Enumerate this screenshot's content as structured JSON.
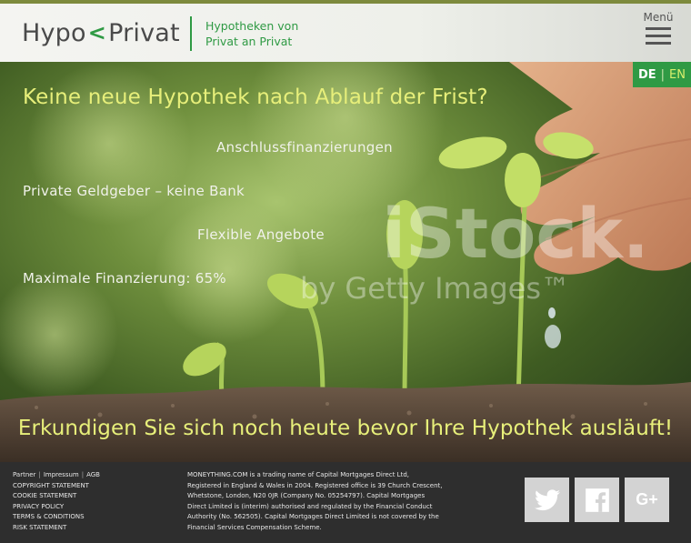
{
  "header": {
    "logo_left": "Hypo",
    "logo_chevron": "<",
    "logo_right": "Privat",
    "tagline_line1": "Hypotheken von",
    "tagline_line2": "Privat an Privat",
    "menu_label": "Menü"
  },
  "language": {
    "de": "DE",
    "separator": "|",
    "en": "EN"
  },
  "hero": {
    "title": "Keine neue Hypothek nach Ablauf der Frist?",
    "features": [
      "Anschlussfinanzierungen",
      "Private Geldgeber – keine Bank",
      "Flexible Angebote",
      "Maximale Finanzierung: 65%"
    ],
    "watermark_logo": "iStock.",
    "watermark_text": "by Getty Images™",
    "cta": "Erkundigen Sie sich noch heute bevor Ihre Hypothek ausläuft!"
  },
  "footer": {
    "links_row1": [
      "Partner",
      "Impressum",
      "AGB"
    ],
    "links": [
      "COPYRIGHT STATEMENT",
      "COOKIE STATEMENT",
      "PRIVACY POLICY",
      "TERMS & CONDITIONS",
      "RISK STATEMENT"
    ],
    "legal_lines": [
      "MONEYTHING.COM is a trading name of Capital Mortgages Direct Ltd,",
      "Registered in England & Wales in 2004. Registered office is 39 Church Crescent,",
      "Whetstone, London, N20 0JR (Company No. 05254797). Capital Mortgages",
      "Direct Limited is (interim) authorised and regulated by the Financial Conduct",
      "Authority (No. 562505). Capital Mortgages Direct Limited is not covered by the",
      "Financial Services Compensation Scheme."
    ],
    "social": [
      "twitter-icon",
      "facebook-icon",
      "google-plus-icon"
    ],
    "google_plus_label": "G+"
  },
  "colors": {
    "brand_green": "#2f9a44",
    "headline_yellow": "#e7ef7a",
    "footer_bg": "#2e2e2e",
    "social_bg": "#d3d3d3"
  }
}
